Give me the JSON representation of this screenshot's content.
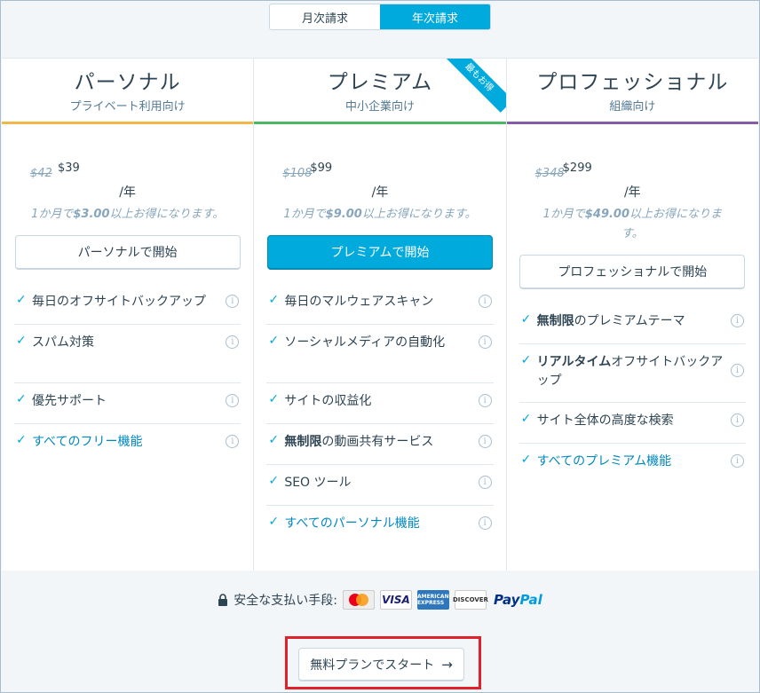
{
  "billing_toggle": {
    "monthly": "月次請求",
    "yearly": "年次請求",
    "selected": "yearly"
  },
  "plans": [
    {
      "name": "パーソナル",
      "subtitle": "プライベート利用向け",
      "price_old": "$42",
      "price_new": "$39",
      "per": "/年",
      "save_pre": "1か月で",
      "save_amount": "$3.00",
      "save_post": "以上お得になります。",
      "cta": "パーソナルで開始",
      "accent": "#f0b849",
      "features": [
        {
          "bold": "",
          "text": "毎日のオフサイトバックアップ"
        },
        {
          "bold": "",
          "text": "スパム対策"
        },
        {
          "bold": "",
          "text": "優先サポート"
        },
        {
          "bold": "",
          "text": "すべてのフリー機能"
        }
      ]
    },
    {
      "name": "プレミアム",
      "subtitle": "中小企業向け",
      "ribbon": "最もお得",
      "price_old": "$108",
      "price_new": "$99",
      "per": "/年",
      "save_pre": "1か月で",
      "save_amount": "$9.00",
      "save_post": "以上お得になります。",
      "cta": "プレミアムで開始",
      "accent": "#4ab866",
      "features": [
        {
          "bold": "",
          "text": "毎日のマルウェアスキャン"
        },
        {
          "bold": "",
          "text": "ソーシャルメディアの自動化"
        },
        {
          "bold": "",
          "text": "サイトの収益化"
        },
        {
          "bold": "無制限",
          "text": "の動画共有サービス"
        },
        {
          "bold": "",
          "text": "SEO ツール"
        },
        {
          "bold": "",
          "text": "すべてのパーソナル機能"
        }
      ]
    },
    {
      "name": "プロフェッショナル",
      "subtitle": "組織向け",
      "price_old": "$348",
      "price_new": "$299",
      "per": "/年",
      "save_pre": "1か月で",
      "save_amount": "$49.00",
      "save_post": "以上お得になります。",
      "cta": "プロフェッショナルで開始",
      "accent": "#855da6",
      "features": [
        {
          "bold": "無制限",
          "text": "のプレミアムテーマ"
        },
        {
          "bold": "リアルタイム",
          "text": "オフサイトバックアップ"
        },
        {
          "bold": "",
          "text": "サイト全体の高度な検索"
        },
        {
          "bold": "",
          "text": "すべてのプレミアム機能"
        }
      ]
    }
  ],
  "payment": {
    "label": "安全な支払い手段:",
    "cards": [
      "MasterCard",
      "VISA",
      "AMERICAN EXPRESS",
      "DISCOVER"
    ],
    "paypal_1": "Pay",
    "paypal_2": "Pal"
  },
  "free_start": {
    "label": "無料プランでスタート",
    "arrow": "→"
  }
}
